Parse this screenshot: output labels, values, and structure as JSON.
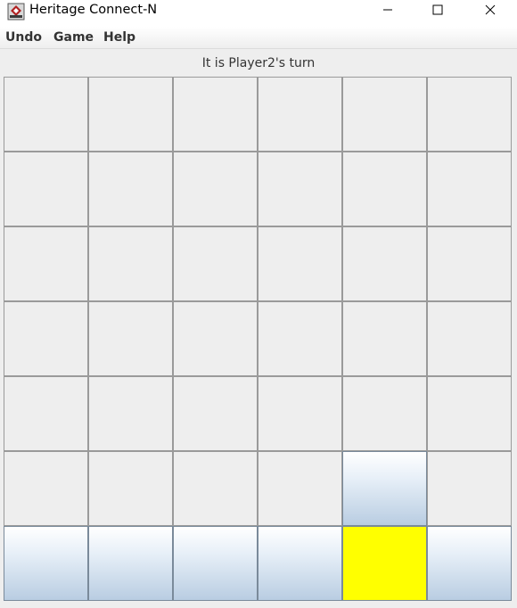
{
  "window": {
    "title": "Heritage Connect-N",
    "controls": [
      "minimize",
      "maximize",
      "close"
    ]
  },
  "menu": {
    "items": [
      "Undo",
      "Game",
      "Help"
    ]
  },
  "status": {
    "text": "It is Player2's turn"
  },
  "board": {
    "columns": 6,
    "rows": 7,
    "cells": [
      [
        "empty",
        "empty",
        "empty",
        "empty",
        "empty",
        "empty"
      ],
      [
        "empty",
        "empty",
        "empty",
        "empty",
        "empty",
        "empty"
      ],
      [
        "empty",
        "empty",
        "empty",
        "empty",
        "empty",
        "empty"
      ],
      [
        "empty",
        "empty",
        "empty",
        "empty",
        "empty",
        "empty"
      ],
      [
        "empty",
        "empty",
        "empty",
        "empty",
        "empty",
        "empty"
      ],
      [
        "empty",
        "empty",
        "empty",
        "empty",
        "highlight",
        "empty"
      ],
      [
        "highlight",
        "highlight",
        "highlight",
        "highlight",
        "yellow",
        "highlight"
      ]
    ]
  },
  "colors": {
    "yellow_piece": "#ffff00",
    "background": "#eeeeee"
  }
}
